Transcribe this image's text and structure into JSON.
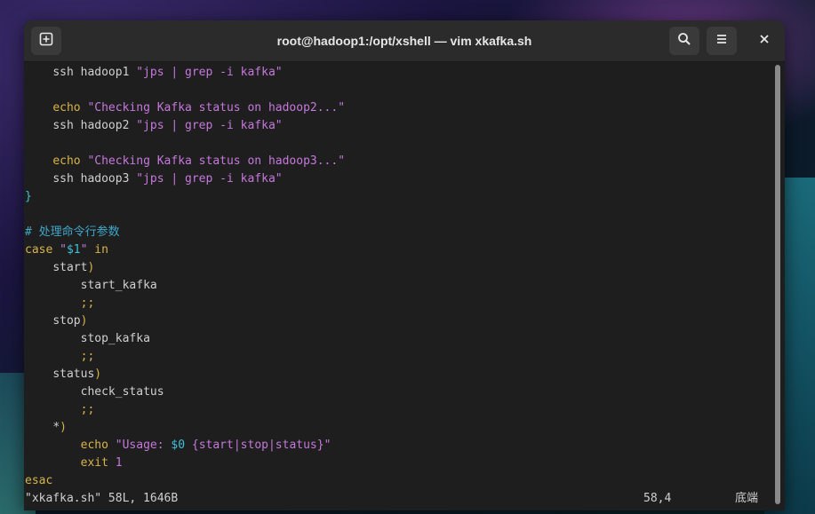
{
  "window": {
    "title": "root@hadoop1:/opt/xshell — vim xkafka.sh"
  },
  "icons": {
    "new_tab": "new-tab-icon",
    "search": "search-icon",
    "menu": "hamburger-menu-icon",
    "close": "close-icon"
  },
  "colors": {
    "keyword": "#d8b44a",
    "string": "#c678dd",
    "comment": "#3fa7c9",
    "brace": "#3fc1d9",
    "text": "#d0d0d0",
    "background": "#1e1e1e"
  },
  "code": {
    "l1": {
      "indent": "    ",
      "cmd": "ssh hadoop1 ",
      "str": "\"jps | grep -i kafka\""
    },
    "l3": {
      "indent": "    ",
      "kw": "echo",
      "str": " \"Checking Kafka status on hadoop2...\""
    },
    "l4": {
      "indent": "    ",
      "cmd": "ssh hadoop2 ",
      "str": "\"jps | grep -i kafka\""
    },
    "l6": {
      "indent": "    ",
      "kw": "echo",
      "str": " \"Checking Kafka status on hadoop3...\""
    },
    "l7": {
      "indent": "    ",
      "cmd": "ssh hadoop3 ",
      "str": "\"jps | grep -i kafka\""
    },
    "l8": {
      "brace": "}"
    },
    "l10": {
      "comment": "# 处理命令行参数"
    },
    "l11": {
      "kw1": "case",
      "q1": " \"",
      "var": "$1",
      "q2": "\" ",
      "kw2": "in"
    },
    "l12": {
      "indent": "    ",
      "text": "start",
      "paren": ")"
    },
    "l13": {
      "indent": "        ",
      "text": "start_kafka"
    },
    "l14": {
      "indent": "        ",
      "kw": ";;"
    },
    "l15": {
      "indent": "    ",
      "text": "stop",
      "paren": ")"
    },
    "l16": {
      "indent": "        ",
      "text": "stop_kafka"
    },
    "l17": {
      "indent": "        ",
      "kw": ";;"
    },
    "l18": {
      "indent": "    ",
      "text": "status",
      "paren": ")"
    },
    "l19": {
      "indent": "        ",
      "text": "check_status"
    },
    "l20": {
      "indent": "        ",
      "kw": ";;"
    },
    "l21": {
      "indent": "    ",
      "text": "*",
      "paren": ")"
    },
    "l22": {
      "indent": "        ",
      "kw": "echo",
      "q": " \"Usage: ",
      "var": "$0",
      "brace": " {start|stop|status}",
      "qend": "\""
    },
    "l23": {
      "indent": "        ",
      "kw": "exit",
      "num": " 1"
    },
    "l24": {
      "kw": "esac"
    }
  },
  "statusline": {
    "file": "\"xkafka.sh\" 58L, 1646B",
    "position": "58,4",
    "scroll": "底端"
  }
}
